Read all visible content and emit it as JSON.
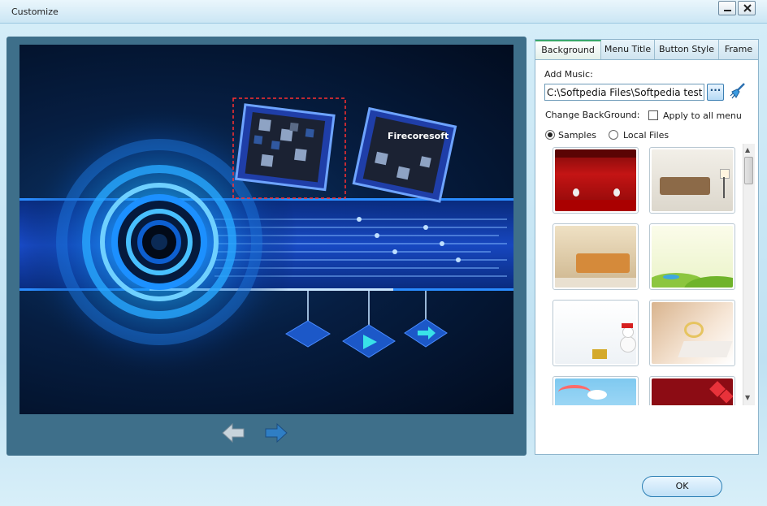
{
  "window": {
    "title": "Customize"
  },
  "tabs": [
    {
      "label": "Background",
      "active": true
    },
    {
      "label": "Menu Title",
      "active": false
    },
    {
      "label": "Button Style",
      "active": false
    },
    {
      "label": "Frame",
      "active": false
    }
  ],
  "background_tab": {
    "add_music_label": "Add Music:",
    "music_path": "C:\\Softpedia Files\\Softpedia test.",
    "browse_label": "···",
    "change_background_label": "Change BackGround:",
    "apply_all_label": "Apply to all menu",
    "apply_all_checked": false,
    "source_options": [
      {
        "label": "Samples",
        "selected": true
      },
      {
        "label": "Local Files",
        "selected": false
      }
    ]
  },
  "preview": {
    "watermark_brand": "Firecoresoft"
  },
  "thumbnails": [
    {
      "name": "red-curtain-stage"
    },
    {
      "name": "beige-sofa-room"
    },
    {
      "name": "orange-sofa-room"
    },
    {
      "name": "green-hills-cartoon"
    },
    {
      "name": "snowman-gifts"
    },
    {
      "name": "wedding-rings"
    },
    {
      "name": "rainbow-cartoon"
    },
    {
      "name": "red-hearts"
    }
  ],
  "footer": {
    "ok_label": "OK"
  },
  "colors": {
    "accent": "#3aa86a",
    "panel": "#3e6f8a",
    "preview_bg": "#061e42"
  }
}
